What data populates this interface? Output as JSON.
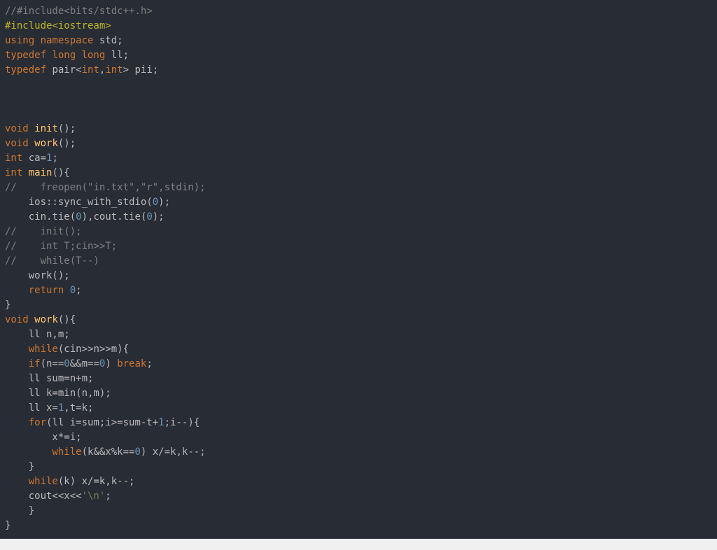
{
  "colors": {
    "background": "#282c34",
    "text": "#bbbbbb",
    "keyword": "#cc7832",
    "function": "#ffc66d",
    "number": "#6897bb",
    "string": "#6a8759",
    "comment": "#808080",
    "preprocessor": "#bbb529"
  },
  "code": {
    "lines": [
      [
        {
          "t": "com",
          "v": "//#include<bits/stdc++.h>"
        }
      ],
      [
        {
          "t": "pp",
          "v": "#include<iostream>"
        }
      ],
      [
        {
          "t": "kw",
          "v": "using namespace"
        },
        {
          "t": "plain",
          "v": " std;"
        }
      ],
      [
        {
          "t": "kw",
          "v": "typedef long long"
        },
        {
          "t": "plain",
          "v": " ll;"
        }
      ],
      [
        {
          "t": "kw",
          "v": "typedef"
        },
        {
          "t": "plain",
          "v": " pair<"
        },
        {
          "t": "kw",
          "v": "int"
        },
        {
          "t": "plain",
          "v": ","
        },
        {
          "t": "kw",
          "v": "int"
        },
        {
          "t": "plain",
          "v": "> pii;"
        }
      ],
      [],
      [],
      [],
      [
        {
          "t": "kw",
          "v": "void"
        },
        {
          "t": "plain",
          "v": " "
        },
        {
          "t": "fn",
          "v": "init"
        },
        {
          "t": "plain",
          "v": "();"
        }
      ],
      [
        {
          "t": "kw",
          "v": "void"
        },
        {
          "t": "plain",
          "v": " "
        },
        {
          "t": "fn",
          "v": "work"
        },
        {
          "t": "plain",
          "v": "();"
        }
      ],
      [
        {
          "t": "kw",
          "v": "int"
        },
        {
          "t": "plain",
          "v": " ca="
        },
        {
          "t": "num",
          "v": "1"
        },
        {
          "t": "plain",
          "v": ";"
        }
      ],
      [
        {
          "t": "kw",
          "v": "int"
        },
        {
          "t": "plain",
          "v": " "
        },
        {
          "t": "fn",
          "v": "main"
        },
        {
          "t": "plain",
          "v": "(){"
        }
      ],
      [
        {
          "t": "com",
          "v": "//    freopen(\"in.txt\",\"r\",stdin);"
        }
      ],
      [
        {
          "t": "plain",
          "v": "    ios::sync_with_stdio("
        },
        {
          "t": "num",
          "v": "0"
        },
        {
          "t": "plain",
          "v": ");"
        }
      ],
      [
        {
          "t": "plain",
          "v": "    cin.tie("
        },
        {
          "t": "num",
          "v": "0"
        },
        {
          "t": "plain",
          "v": "),cout.tie("
        },
        {
          "t": "num",
          "v": "0"
        },
        {
          "t": "plain",
          "v": ");"
        }
      ],
      [
        {
          "t": "com",
          "v": "//    init();"
        }
      ],
      [
        {
          "t": "com",
          "v": "//    int T;cin>>T;"
        }
      ],
      [
        {
          "t": "com",
          "v": "//    while(T--)"
        }
      ],
      [
        {
          "t": "plain",
          "v": "    work();"
        }
      ],
      [
        {
          "t": "plain",
          "v": "    "
        },
        {
          "t": "kw",
          "v": "return"
        },
        {
          "t": "plain",
          "v": " "
        },
        {
          "t": "num",
          "v": "0"
        },
        {
          "t": "plain",
          "v": ";"
        }
      ],
      [
        {
          "t": "plain",
          "v": "}"
        }
      ],
      [
        {
          "t": "kw",
          "v": "void"
        },
        {
          "t": "plain",
          "v": " "
        },
        {
          "t": "fn",
          "v": "work"
        },
        {
          "t": "plain",
          "v": "(){"
        }
      ],
      [
        {
          "t": "plain",
          "v": "    ll n,m;"
        }
      ],
      [
        {
          "t": "plain",
          "v": "    "
        },
        {
          "t": "kw",
          "v": "while"
        },
        {
          "t": "plain",
          "v": "(cin>>n>>m){"
        }
      ],
      [
        {
          "t": "plain",
          "v": "    "
        },
        {
          "t": "kw",
          "v": "if"
        },
        {
          "t": "plain",
          "v": "(n=="
        },
        {
          "t": "num",
          "v": "0"
        },
        {
          "t": "plain",
          "v": "&&m=="
        },
        {
          "t": "num",
          "v": "0"
        },
        {
          "t": "plain",
          "v": ") "
        },
        {
          "t": "kw",
          "v": "break"
        },
        {
          "t": "plain",
          "v": ";"
        }
      ],
      [
        {
          "t": "plain",
          "v": "    ll sum=n+m;"
        }
      ],
      [
        {
          "t": "plain",
          "v": "    ll k=min(n,m);"
        }
      ],
      [
        {
          "t": "plain",
          "v": "    ll x="
        },
        {
          "t": "num",
          "v": "1"
        },
        {
          "t": "plain",
          "v": ",t=k;"
        }
      ],
      [
        {
          "t": "plain",
          "v": "    "
        },
        {
          "t": "kw",
          "v": "for"
        },
        {
          "t": "plain",
          "v": "(ll i=sum;i>=sum-t+"
        },
        {
          "t": "num",
          "v": "1"
        },
        {
          "t": "plain",
          "v": ";i--){"
        }
      ],
      [
        {
          "t": "plain",
          "v": "        x*=i;"
        }
      ],
      [
        {
          "t": "plain",
          "v": "        "
        },
        {
          "t": "kw",
          "v": "while"
        },
        {
          "t": "plain",
          "v": "(k&&x%k=="
        },
        {
          "t": "num",
          "v": "0"
        },
        {
          "t": "plain",
          "v": ") x/=k,k--;"
        }
      ],
      [
        {
          "t": "plain",
          "v": "    }"
        }
      ],
      [
        {
          "t": "plain",
          "v": "    "
        },
        {
          "t": "kw",
          "v": "while"
        },
        {
          "t": "plain",
          "v": "(k) x/=k,k--;"
        }
      ],
      [
        {
          "t": "plain",
          "v": "    cout<<x<<"
        },
        {
          "t": "str",
          "v": "'\\n'"
        },
        {
          "t": "plain",
          "v": ";"
        }
      ],
      [
        {
          "t": "plain",
          "v": "    }"
        }
      ],
      [
        {
          "t": "plain",
          "v": "}"
        }
      ]
    ]
  }
}
